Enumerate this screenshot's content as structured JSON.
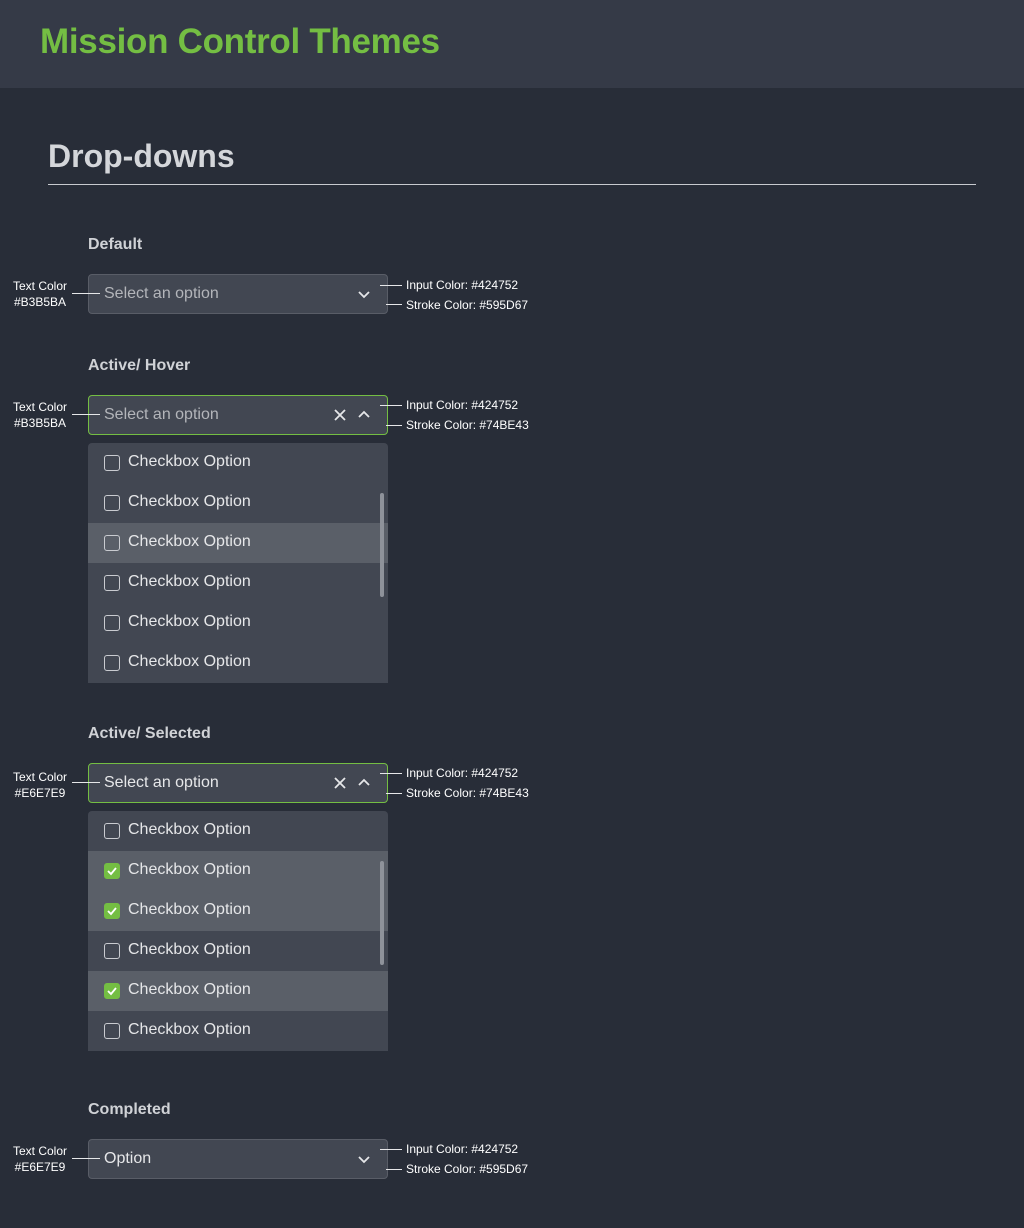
{
  "app_title": "Mission Control Themes",
  "section_title": "Drop-downs",
  "colors": {
    "accent": "#74BE43",
    "input": "#424752",
    "stroke_default": "#595D67",
    "text_placeholder": "#B3B5BA",
    "text_filled": "#E6E7E9"
  },
  "states": {
    "default": {
      "label": "Default",
      "placeholder": "Select an option",
      "text_color_label": "Text Color",
      "text_color_value": "#B3B5BA",
      "input_color": "Input Color: #424752",
      "stroke_color": "Stroke Color: #595D67"
    },
    "hover": {
      "label": "Active/ Hover",
      "placeholder": "Select an option",
      "text_color_label": "Text Color",
      "text_color_value": "#B3B5BA",
      "input_color": "Input Color: #424752",
      "stroke_color": "Stroke Color: #74BE43",
      "options": [
        {
          "label": "Checkbox Option",
          "checked": false
        },
        {
          "label": "Checkbox Option",
          "checked": false
        },
        {
          "label": "Checkbox Option",
          "checked": false
        },
        {
          "label": "Checkbox Option",
          "checked": false
        },
        {
          "label": "Checkbox Option",
          "checked": false
        },
        {
          "label": "Checkbox Option",
          "checked": false
        }
      ]
    },
    "selected": {
      "label": "Active/ Selected",
      "placeholder": "Select an option",
      "text_color_label": "Text Color",
      "text_color_value": "#E6E7E9",
      "input_color": "Input Color: #424752",
      "stroke_color": "Stroke Color: #74BE43",
      "options": [
        {
          "label": "Checkbox Option",
          "checked": false
        },
        {
          "label": "Checkbox Option",
          "checked": true
        },
        {
          "label": "Checkbox Option",
          "checked": true
        },
        {
          "label": "Checkbox Option",
          "checked": false
        },
        {
          "label": "Checkbox Option",
          "checked": true
        },
        {
          "label": "Checkbox Option",
          "checked": false
        }
      ]
    },
    "completed": {
      "label": "Completed",
      "value": "Option",
      "text_color_label": "Text Color",
      "text_color_value": "#E6E7E9",
      "input_color": "Input Color: #424752",
      "stroke_color": "Stroke Color: #595D67"
    }
  }
}
